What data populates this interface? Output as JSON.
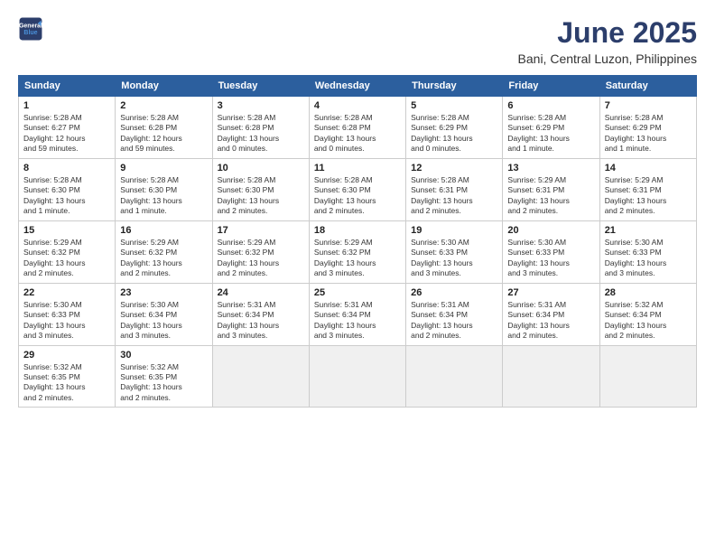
{
  "header": {
    "logo_line1": "General",
    "logo_line2": "Blue",
    "month": "June 2025",
    "location": "Bani, Central Luzon, Philippines"
  },
  "weekdays": [
    "Sunday",
    "Monday",
    "Tuesday",
    "Wednesday",
    "Thursday",
    "Friday",
    "Saturday"
  ],
  "weeks": [
    [
      {
        "day": "1",
        "info": "Sunrise: 5:28 AM\nSunset: 6:27 PM\nDaylight: 12 hours\nand 59 minutes."
      },
      {
        "day": "2",
        "info": "Sunrise: 5:28 AM\nSunset: 6:28 PM\nDaylight: 12 hours\nand 59 minutes."
      },
      {
        "day": "3",
        "info": "Sunrise: 5:28 AM\nSunset: 6:28 PM\nDaylight: 13 hours\nand 0 minutes."
      },
      {
        "day": "4",
        "info": "Sunrise: 5:28 AM\nSunset: 6:28 PM\nDaylight: 13 hours\nand 0 minutes."
      },
      {
        "day": "5",
        "info": "Sunrise: 5:28 AM\nSunset: 6:29 PM\nDaylight: 13 hours\nand 0 minutes."
      },
      {
        "day": "6",
        "info": "Sunrise: 5:28 AM\nSunset: 6:29 PM\nDaylight: 13 hours\nand 1 minute."
      },
      {
        "day": "7",
        "info": "Sunrise: 5:28 AM\nSunset: 6:29 PM\nDaylight: 13 hours\nand 1 minute."
      }
    ],
    [
      {
        "day": "8",
        "info": "Sunrise: 5:28 AM\nSunset: 6:30 PM\nDaylight: 13 hours\nand 1 minute."
      },
      {
        "day": "9",
        "info": "Sunrise: 5:28 AM\nSunset: 6:30 PM\nDaylight: 13 hours\nand 1 minute."
      },
      {
        "day": "10",
        "info": "Sunrise: 5:28 AM\nSunset: 6:30 PM\nDaylight: 13 hours\nand 2 minutes."
      },
      {
        "day": "11",
        "info": "Sunrise: 5:28 AM\nSunset: 6:30 PM\nDaylight: 13 hours\nand 2 minutes."
      },
      {
        "day": "12",
        "info": "Sunrise: 5:28 AM\nSunset: 6:31 PM\nDaylight: 13 hours\nand 2 minutes."
      },
      {
        "day": "13",
        "info": "Sunrise: 5:29 AM\nSunset: 6:31 PM\nDaylight: 13 hours\nand 2 minutes."
      },
      {
        "day": "14",
        "info": "Sunrise: 5:29 AM\nSunset: 6:31 PM\nDaylight: 13 hours\nand 2 minutes."
      }
    ],
    [
      {
        "day": "15",
        "info": "Sunrise: 5:29 AM\nSunset: 6:32 PM\nDaylight: 13 hours\nand 2 minutes."
      },
      {
        "day": "16",
        "info": "Sunrise: 5:29 AM\nSunset: 6:32 PM\nDaylight: 13 hours\nand 2 minutes."
      },
      {
        "day": "17",
        "info": "Sunrise: 5:29 AM\nSunset: 6:32 PM\nDaylight: 13 hours\nand 2 minutes."
      },
      {
        "day": "18",
        "info": "Sunrise: 5:29 AM\nSunset: 6:32 PM\nDaylight: 13 hours\nand 3 minutes."
      },
      {
        "day": "19",
        "info": "Sunrise: 5:30 AM\nSunset: 6:33 PM\nDaylight: 13 hours\nand 3 minutes."
      },
      {
        "day": "20",
        "info": "Sunrise: 5:30 AM\nSunset: 6:33 PM\nDaylight: 13 hours\nand 3 minutes."
      },
      {
        "day": "21",
        "info": "Sunrise: 5:30 AM\nSunset: 6:33 PM\nDaylight: 13 hours\nand 3 minutes."
      }
    ],
    [
      {
        "day": "22",
        "info": "Sunrise: 5:30 AM\nSunset: 6:33 PM\nDaylight: 13 hours\nand 3 minutes."
      },
      {
        "day": "23",
        "info": "Sunrise: 5:30 AM\nSunset: 6:34 PM\nDaylight: 13 hours\nand 3 minutes."
      },
      {
        "day": "24",
        "info": "Sunrise: 5:31 AM\nSunset: 6:34 PM\nDaylight: 13 hours\nand 3 minutes."
      },
      {
        "day": "25",
        "info": "Sunrise: 5:31 AM\nSunset: 6:34 PM\nDaylight: 13 hours\nand 3 minutes."
      },
      {
        "day": "26",
        "info": "Sunrise: 5:31 AM\nSunset: 6:34 PM\nDaylight: 13 hours\nand 2 minutes."
      },
      {
        "day": "27",
        "info": "Sunrise: 5:31 AM\nSunset: 6:34 PM\nDaylight: 13 hours\nand 2 minutes."
      },
      {
        "day": "28",
        "info": "Sunrise: 5:32 AM\nSunset: 6:34 PM\nDaylight: 13 hours\nand 2 minutes."
      }
    ],
    [
      {
        "day": "29",
        "info": "Sunrise: 5:32 AM\nSunset: 6:35 PM\nDaylight: 13 hours\nand 2 minutes."
      },
      {
        "day": "30",
        "info": "Sunrise: 5:32 AM\nSunset: 6:35 PM\nDaylight: 13 hours\nand 2 minutes."
      },
      {
        "day": "",
        "info": ""
      },
      {
        "day": "",
        "info": ""
      },
      {
        "day": "",
        "info": ""
      },
      {
        "day": "",
        "info": ""
      },
      {
        "day": "",
        "info": ""
      }
    ]
  ]
}
